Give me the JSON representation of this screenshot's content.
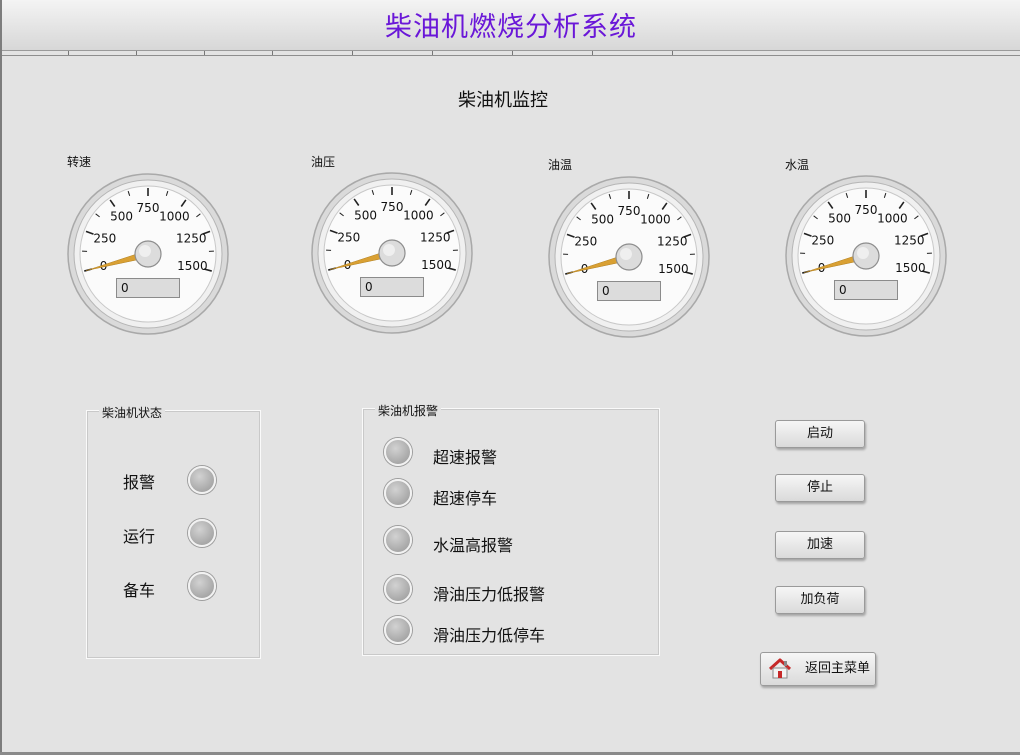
{
  "app": {
    "title": "柴油机燃烧分析系统"
  },
  "section": {
    "title": "柴油机监控"
  },
  "gauges": [
    {
      "label": "转速",
      "value": 0,
      "readout": "0"
    },
    {
      "label": "油压",
      "value": 0,
      "readout": "0"
    },
    {
      "label": "油温",
      "value": 0,
      "readout": "0"
    },
    {
      "label": "水温",
      "value": 0,
      "readout": "0"
    }
  ],
  "gauge_scale": {
    "min": 0,
    "max": 1500,
    "labels": [
      "0",
      "250",
      "500",
      "750",
      "1000",
      "1250",
      "1500"
    ]
  },
  "status_group": {
    "title": "柴油机状态",
    "items": [
      {
        "label": "报警"
      },
      {
        "label": "运行"
      },
      {
        "label": "备车"
      }
    ]
  },
  "alarm_group": {
    "title": "柴油机报警",
    "items": [
      {
        "label": "超速报警"
      },
      {
        "label": "超速停车"
      },
      {
        "label": "水温高报警"
      },
      {
        "label": "滑油压力低报警"
      },
      {
        "label": "滑油压力低停车"
      }
    ]
  },
  "buttons": {
    "start": "启动",
    "stop": "停止",
    "accelerate": "加速",
    "add_load": "加负荷",
    "back_to_menu": "返回主菜单"
  },
  "colors": {
    "title_text": "#6a17d8",
    "needle": "#d9a033",
    "led_off": "#b4b4b4",
    "background": "#e3e3e3"
  },
  "icons": {
    "back_to_menu": "home-icon"
  }
}
